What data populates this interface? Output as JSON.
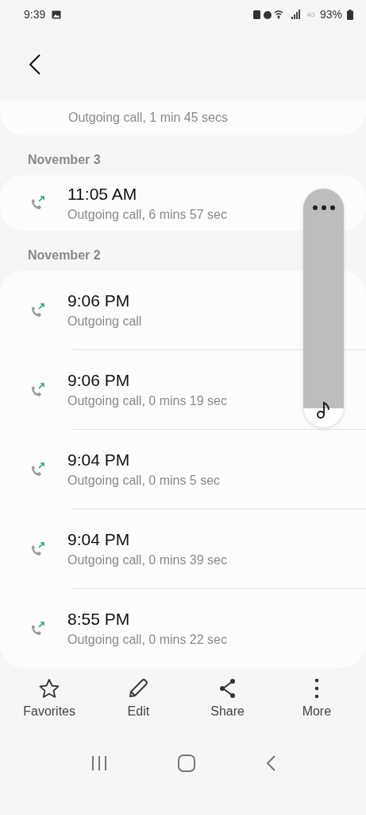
{
  "status_bar": {
    "time": "9:39",
    "network": "4G",
    "battery": "93%"
  },
  "previous_call": {
    "description": "Outgoing call, 1 min 45 secs"
  },
  "groups": [
    {
      "date": "November 3",
      "calls": [
        {
          "time": "11:05 AM",
          "description": "Outgoing call, 6 mins 57 sec"
        }
      ]
    },
    {
      "date": "November 2",
      "calls": [
        {
          "time": "9:06 PM",
          "description": "Outgoing call"
        },
        {
          "time": "9:06 PM",
          "description": "Outgoing call, 0 mins 19 sec"
        },
        {
          "time": "9:04 PM",
          "description": "Outgoing call, 0 mins 5 sec"
        },
        {
          "time": "9:04 PM",
          "description": "Outgoing call, 0 mins 39 sec"
        },
        {
          "time": "8:55 PM",
          "description": "Outgoing call, 0 mins 22 sec"
        }
      ]
    }
  ],
  "toolbar": [
    {
      "label": "Favorites",
      "kind": "star"
    },
    {
      "label": "Edit",
      "kind": "pencil"
    },
    {
      "label": "Share",
      "kind": "share"
    },
    {
      "label": "More",
      "kind": "dots"
    }
  ]
}
